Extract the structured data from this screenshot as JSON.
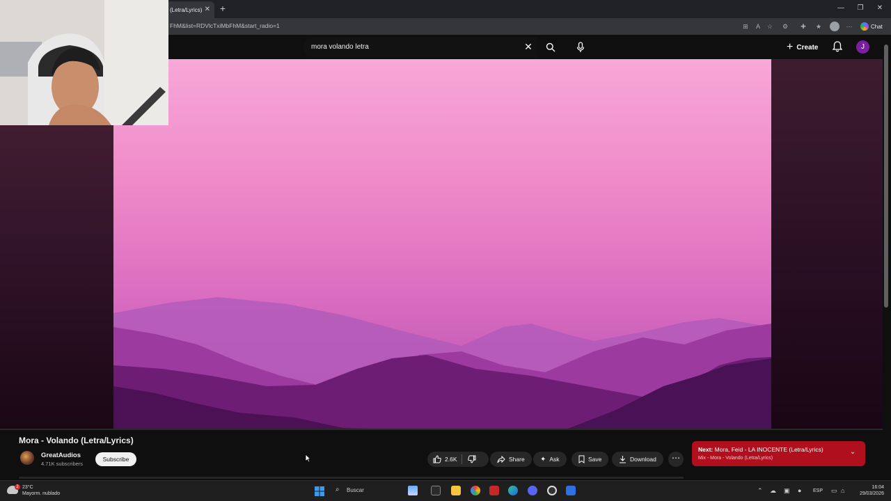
{
  "browser": {
    "tab_title": "(Letra/Lyrics)",
    "url": "FhM&list=RDVlcTxiMbFhM&start_radio=1",
    "chat_label": "Chat"
  },
  "youtube": {
    "search_query": "mora volando letra",
    "create_label": "Create",
    "avatar_letter": "J"
  },
  "video": {
    "title": "Mora - Volando (Letra/Lyrics)",
    "channel_name": "GreatAudios",
    "subscribers": "4.71K subscribers",
    "subscribe_label": "Subscribe",
    "likes": "2.6K",
    "share_label": "Share",
    "ask_label": "Ask",
    "save_label": "Save",
    "download_label": "Download"
  },
  "next": {
    "prefix": "Next:",
    "title": "Mora, Feid - LA INOCENTE (Letra/Lyrics)",
    "mix": "Mix - Mora - Volando (Letra/Lyrics)"
  },
  "taskbar": {
    "weather_badge": "2",
    "temperature": "23°C",
    "weather_desc": "Mayorm. nublado",
    "search_label": "Buscar",
    "language": "ESP",
    "time": "16:04",
    "date": "29/03/2026"
  },
  "colors": {
    "next_box": "#b0101e",
    "avatar": "#7b1fa2"
  }
}
